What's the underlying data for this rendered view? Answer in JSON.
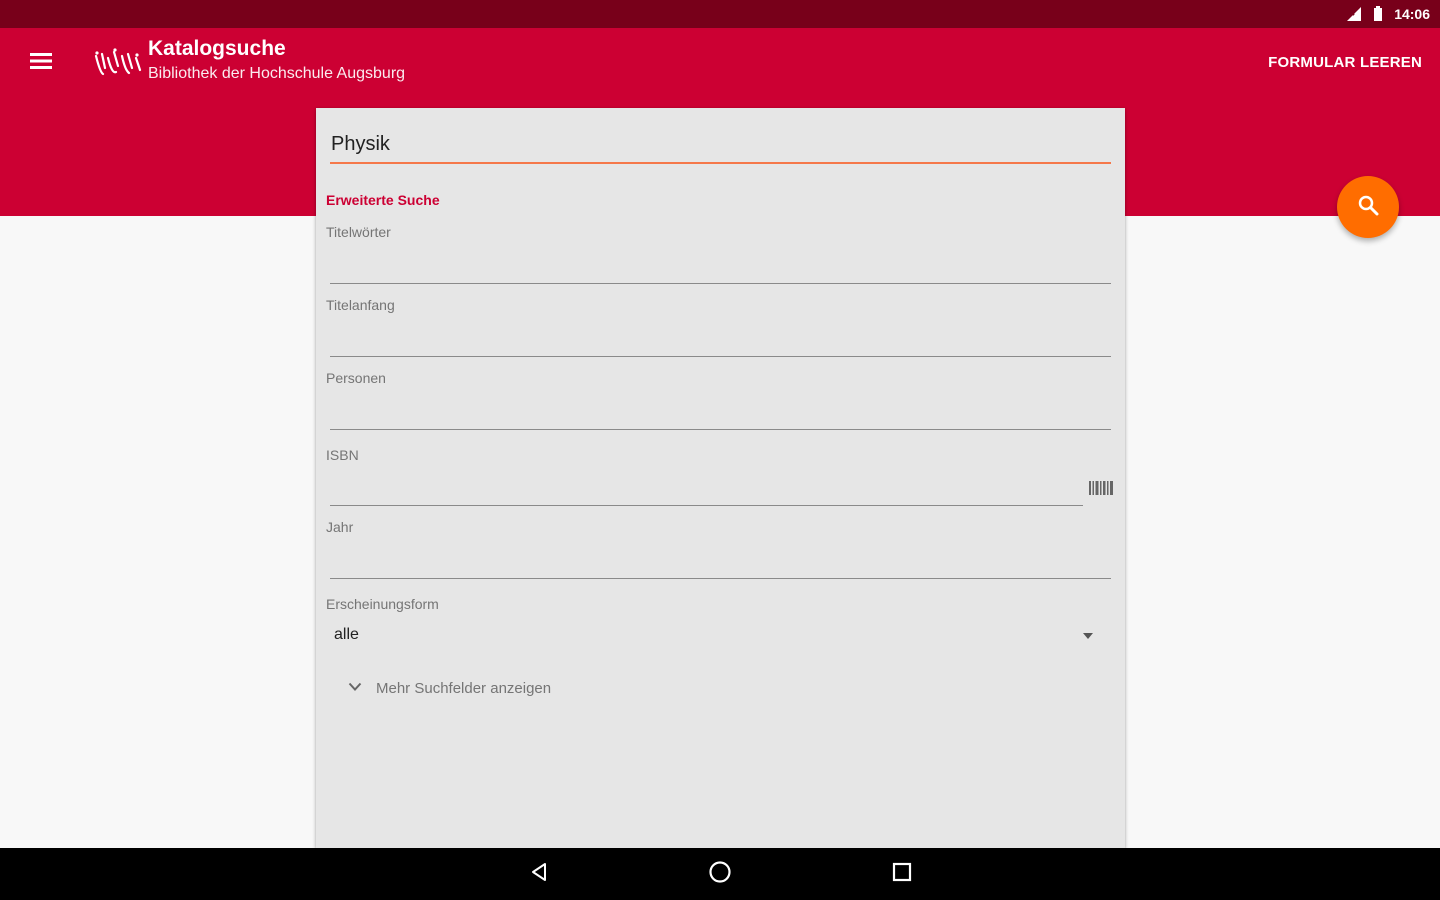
{
  "status_bar": {
    "time": "14:06",
    "icons": [
      "signal-icon",
      "battery-icon"
    ]
  },
  "app_bar": {
    "title": "Katalogsuche",
    "subtitle": "Bibliothek der Hochschule Augsburg",
    "action_label": "FORMULAR LEEREN",
    "colors": {
      "app_bar": "#cc0033",
      "status_bar": "#78001a",
      "accent": "#ff6d00"
    }
  },
  "search_form": {
    "query_value": "Physik",
    "section_heading": "Erweiterte Suche",
    "fields": [
      {
        "label": "Titelwörter",
        "value": ""
      },
      {
        "label": "Titelanfang",
        "value": ""
      },
      {
        "label": "Personen",
        "value": ""
      },
      {
        "label": "ISBN",
        "value": ""
      },
      {
        "label": "Jahr",
        "value": ""
      }
    ],
    "publication_form": {
      "label": "Erscheinungsform",
      "selected": "alle"
    },
    "more_fields_label": "Mehr Suchfelder anzeigen"
  },
  "icons": {
    "menu": "menu-icon",
    "search": "search-icon",
    "barcode": "barcode-icon",
    "dropdown": "dropdown-arrow-icon",
    "expand": "chevron-down-icon",
    "nav": [
      "back-icon",
      "home-icon",
      "recents-icon"
    ]
  }
}
